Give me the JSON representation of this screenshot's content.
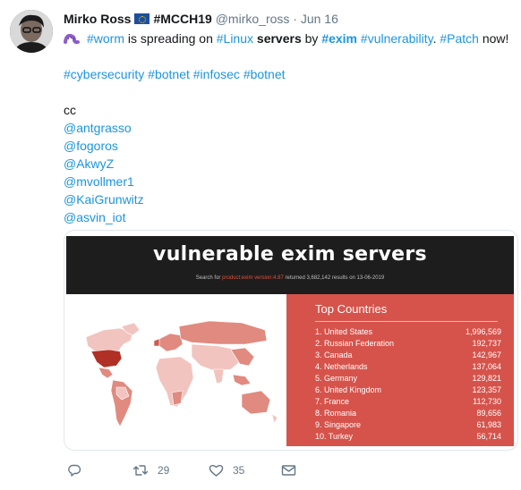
{
  "tweet": {
    "author_name": "Mirko Ross",
    "account_tag": "#MCCH19",
    "handle": "@mirko_ross",
    "separator": "·",
    "date": "Jun 16",
    "text": {
      "worm": "#worm",
      "t1": " is spreading on ",
      "linux": "#Linux",
      "t2": " ",
      "servers": "servers",
      "t3": " by ",
      "exim": "#exim",
      "t4": " ",
      "vuln": "#vulnerability",
      "t5": ". ",
      "patch": "#Patch",
      "t6": " now!"
    },
    "hashtags": [
      "#cybersecurity",
      "#botnet",
      "#infosec",
      "#botnet"
    ],
    "cc": "cc",
    "mentions": [
      "@antgrasso",
      "@fogoros",
      "@AkwyZ",
      "@mvollmer1",
      "@KaiGrunwitz",
      "@asvin_iot"
    ]
  },
  "media": {
    "title": "vulnerable exim servers",
    "subtitle_before": "Search for",
    "subtitle_query": "product:exim version:4.87",
    "subtitle_after": "returned 3,682,142 results on 13-06-2019",
    "panel_title": "Top Countries",
    "countries": [
      {
        "label": "1. United States",
        "value": "1,996,569"
      },
      {
        "label": "2. Russian Federation",
        "value": "192,737"
      },
      {
        "label": "3. Canada",
        "value": "142,967"
      },
      {
        "label": "4. Netherlands",
        "value": "137,064"
      },
      {
        "label": "5. Germany",
        "value": "129,821"
      },
      {
        "label": "6. United Kingdom",
        "value": "123,357"
      },
      {
        "label": "7. France",
        "value": "112,730"
      },
      {
        "label": "8. Romania",
        "value": "89,656"
      },
      {
        "label": "9. Singapore",
        "value": "61,983"
      },
      {
        "label": "10. Turkey",
        "value": "56,714"
      }
    ],
    "colors": {
      "banner": "#1d1d1d",
      "panel": "#d6534b",
      "map_dark": "#b03025",
      "map_mid": "#e08a80",
      "map_light": "#f2c4bf"
    }
  },
  "actions": {
    "reply_icon": "reply-icon",
    "retweet_icon": "retweet-icon",
    "retweet_count": "29",
    "like_icon": "heart-icon",
    "like_count": "35",
    "dm_icon": "envelope-icon"
  }
}
